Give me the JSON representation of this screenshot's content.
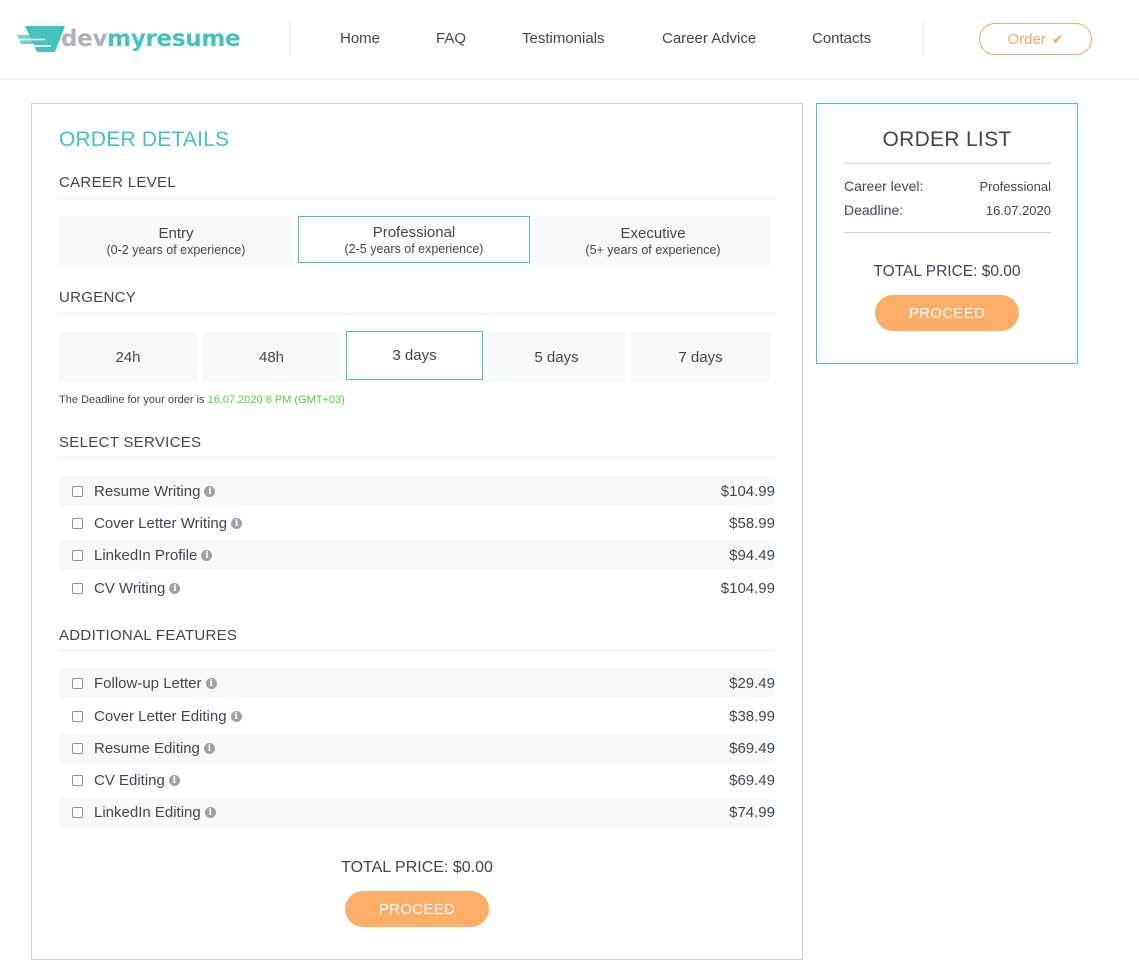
{
  "brand": {
    "part1": "dev",
    "part2": "myresume",
    "accent": "#45c2c0",
    "muted": "#a9b3bd"
  },
  "nav": {
    "home": "Home",
    "faq": "FAQ",
    "testimonials": "Testimonials",
    "career_advice": "Career Advice",
    "contacts": "Contacts",
    "order": "Order",
    "order_icon": "check-icon"
  },
  "order_details": {
    "title": "ORDER DETAILS",
    "career_level": {
      "heading": "CAREER LEVEL",
      "options": [
        {
          "label": "Entry",
          "sub": "(0-2 years of experience)"
        },
        {
          "label": "Professional",
          "sub": "(2-5 years of experience)"
        },
        {
          "label": "Executive",
          "sub": "(5+ years of experience)"
        }
      ],
      "selected": "Professional"
    },
    "urgency": {
      "heading": "URGENCY",
      "options": [
        "24h",
        "48h",
        "3 days",
        "5 days",
        "7 days"
      ],
      "selected": "3 days"
    },
    "deadline_note": {
      "text": "The Deadline for your order is ",
      "value": "16.07.2020 6 PM (GMT+03)"
    },
    "services": {
      "heading": "SELECT SERVICES",
      "items": [
        {
          "label": "Resume Writing",
          "price": "$104.99"
        },
        {
          "label": "Cover Letter Writing",
          "price": "$58.99"
        },
        {
          "label": "LinkedIn Profile",
          "price": "$94.49"
        },
        {
          "label": "CV Writing",
          "price": "$104.99"
        }
      ]
    },
    "features": {
      "heading": "ADDITIONAL FEATURES",
      "items": [
        {
          "label": "Follow-up Letter",
          "price": "$29.49"
        },
        {
          "label": "Cover Letter Editing",
          "price": "$38.99"
        },
        {
          "label": "Resume Editing",
          "price": "$69.49"
        },
        {
          "label": "CV Editing",
          "price": "$69.49"
        },
        {
          "label": "LinkedIn Editing",
          "price": "$74.99"
        }
      ]
    },
    "total_price": "TOTAL PRICE: $0.00",
    "proceed": "PROCEED"
  },
  "order_list": {
    "title": "ORDER LIST",
    "career_level_label": "Career level:",
    "career_level_value": "Professional",
    "deadline_label": "Deadline:",
    "deadline_value": "16.07.2020",
    "total_price": "TOTAL PRICE: $0.00",
    "proceed": "PROCEED"
  },
  "colors": {
    "accent": "#45c2c0",
    "orange": "#fcae68",
    "order_outline": "#f8a85d",
    "deadline_green": "#5ac846",
    "row_shade": "#f7fafc"
  }
}
